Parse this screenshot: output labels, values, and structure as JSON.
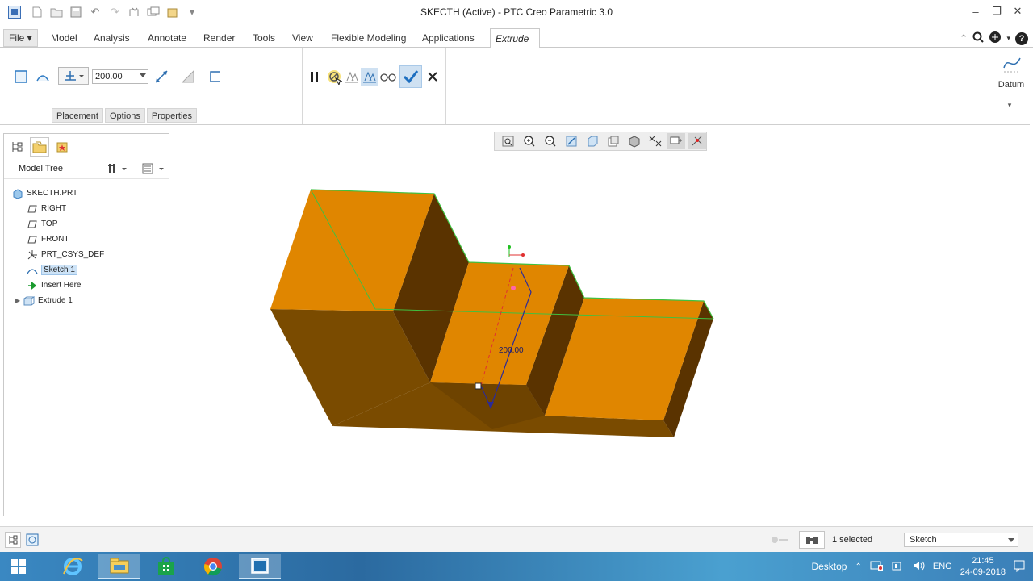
{
  "window": {
    "title": "SKECTH (Active) - PTC Creo Parametric 3.0"
  },
  "ribbon_tabs": [
    {
      "label": "File ▾"
    },
    {
      "label": "Model"
    },
    {
      "label": "Analysis"
    },
    {
      "label": "Annotate"
    },
    {
      "label": "Render"
    },
    {
      "label": "Tools"
    },
    {
      "label": "View"
    },
    {
      "label": "Flexible Modeling"
    },
    {
      "label": "Applications"
    },
    {
      "label": "Extrude"
    }
  ],
  "extrude": {
    "depth_value": "200.00",
    "subtabs": [
      "Placement",
      "Options",
      "Properties"
    ],
    "datum_label": "Datum"
  },
  "model_tree": {
    "title": "Model Tree",
    "items": [
      {
        "label": "SKECTH.PRT",
        "icon": "part-icon"
      },
      {
        "label": "RIGHT",
        "icon": "datum-plane-icon"
      },
      {
        "label": "TOP",
        "icon": "datum-plane-icon"
      },
      {
        "label": "FRONT",
        "icon": "datum-plane-icon"
      },
      {
        "label": "PRT_CSYS_DEF",
        "icon": "csys-icon"
      },
      {
        "label": "Sketch 1",
        "icon": "sketch-icon",
        "selected": true
      },
      {
        "label": "Insert Here",
        "icon": "insert-arrow-icon"
      },
      {
        "label": "Extrude 1",
        "icon": "extrude-icon"
      }
    ]
  },
  "model_view": {
    "dimension_label": "200.00",
    "colors": {
      "top_face": "#e08600",
      "side_face": "#7a4b00",
      "dark_face": "#5a3300",
      "edge_highlight": "#40c040"
    }
  },
  "status": {
    "selection": "1 selected",
    "filter": "Sketch"
  },
  "taskbar": {
    "desktop_label": "Desktop",
    "language": "ENG",
    "time": "21:45",
    "date": "24-09-2018"
  }
}
